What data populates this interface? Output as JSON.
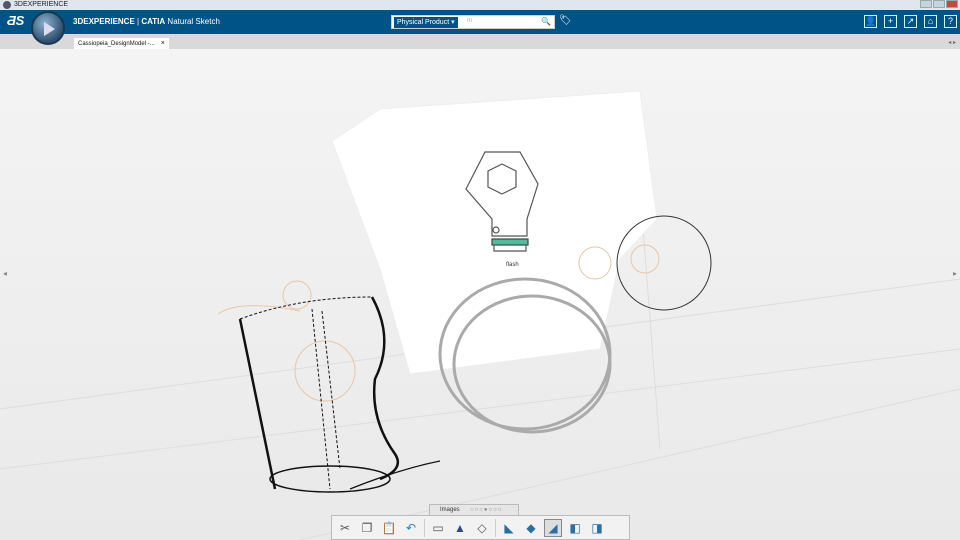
{
  "window": {
    "title": "3DEXPERIENCE"
  },
  "appbar": {
    "brand": "3DEXPERIENCE",
    "separator": " | ",
    "product": "CATIA",
    "app": "Natural Sketch",
    "search": {
      "scope": "Physical Product",
      "placeholder": "In"
    },
    "right_icons": [
      "user-icon",
      "plus-icon",
      "share-icon",
      "home-icon",
      "help-icon"
    ]
  },
  "tabs": [
    {
      "label": "Cassiopeia_DesignModel -...",
      "close": "×"
    }
  ],
  "viewport": {
    "sketch_label": "flash"
  },
  "images_bar": {
    "label": "Images",
    "page_count": 7,
    "current_page": 4
  },
  "toolbar": {
    "tools": [
      {
        "name": "cut",
        "icon": "✂"
      },
      {
        "name": "copy",
        "icon": "❐"
      },
      {
        "name": "paste",
        "icon": "📋"
      },
      {
        "name": "undo",
        "icon": "↶"
      },
      {
        "name": "new-sheet",
        "icon": "▭"
      },
      {
        "name": "ink",
        "icon": "▲"
      },
      {
        "name": "lasso",
        "icon": "◇"
      },
      {
        "name": "stage-1",
        "icon": "◣"
      },
      {
        "name": "stage-2",
        "icon": "◆"
      },
      {
        "name": "stage-3",
        "icon": "◢"
      },
      {
        "name": "stage-4",
        "icon": "◧"
      },
      {
        "name": "stage-5",
        "icon": "◨"
      }
    ],
    "active": "stage-3"
  },
  "colors": {
    "brand": "#005386",
    "accent": "#4bbf9c"
  }
}
